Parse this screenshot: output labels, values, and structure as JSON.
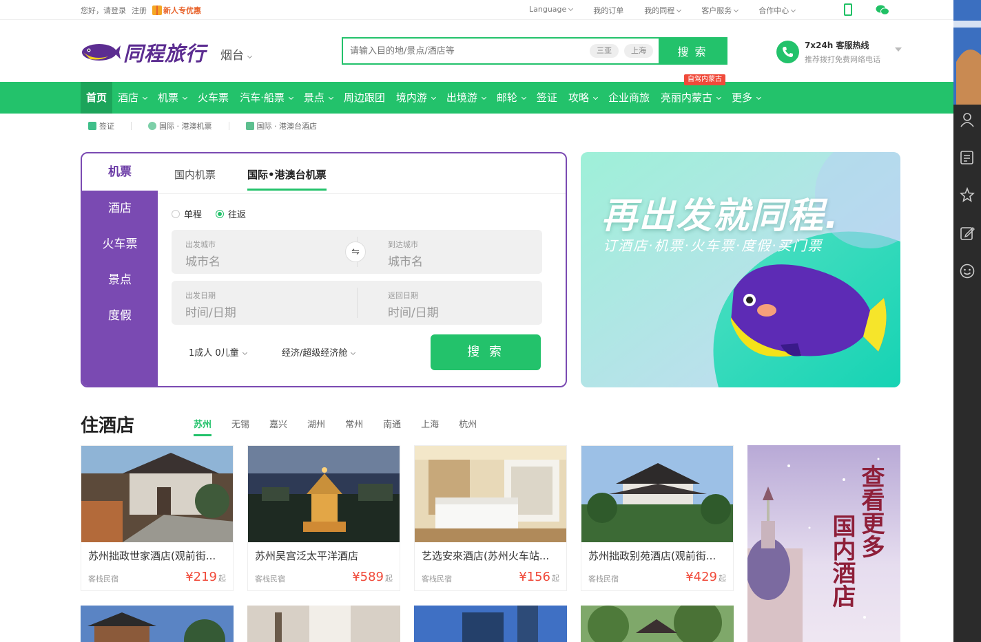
{
  "topbar": {
    "greeting": "您好，请登录",
    "register": "注册",
    "promo": "新人专优惠",
    "language": "Language",
    "my_orders": "我的订单",
    "my_trips": "我的同程",
    "customer_service": "客户服务",
    "partner_center": "合作中心"
  },
  "header": {
    "logo_text": "同程旅行",
    "city": "烟台",
    "search_placeholder": "请输入目的地/景点/酒店等",
    "search_tags": [
      "三亚",
      "上海"
    ],
    "search_button": "搜 索",
    "hotline_title": "7x24h 客服热线",
    "hotline_sub": "推荐拨打免费网络电话"
  },
  "nav": {
    "items": [
      {
        "label": "首页",
        "dropdown": false,
        "active": true
      },
      {
        "label": "酒店",
        "dropdown": true
      },
      {
        "label": "机票",
        "dropdown": true
      },
      {
        "label": "火车票",
        "dropdown": false
      },
      {
        "label": "汽车·船票",
        "dropdown": true
      },
      {
        "label": "景点",
        "dropdown": true
      },
      {
        "label": "周边跟团",
        "dropdown": false
      },
      {
        "label": "境内游",
        "dropdown": true
      },
      {
        "label": "出境游",
        "dropdown": true
      },
      {
        "label": "邮轮",
        "dropdown": true
      },
      {
        "label": "签证",
        "dropdown": false
      },
      {
        "label": "攻略",
        "dropdown": true
      },
      {
        "label": "企业商旅",
        "dropdown": false
      },
      {
        "label": "亮丽内蒙古",
        "dropdown": true,
        "badge": "自驾内蒙古"
      },
      {
        "label": "更多",
        "dropdown": true
      }
    ]
  },
  "subnav": [
    "签证",
    "国际 · 港澳机票",
    "国际 · 港澳台酒店"
  ],
  "booking": {
    "side_items": [
      "机票",
      "酒店",
      "火车票",
      "景点",
      "度假"
    ],
    "tabs": [
      "国内机票",
      "国际•港澳台机票"
    ],
    "trip_types": [
      "单程",
      "往返"
    ],
    "from_label": "出发城市",
    "from_value": "城市名",
    "to_label": "到达城市",
    "to_value": "城市名",
    "depart_label": "出发日期",
    "depart_value": "时间/日期",
    "return_label": "返回日期",
    "return_value": "时间/日期",
    "passengers": "1成人 0儿童",
    "cabin": "经济/超级经济舱",
    "search_button": "搜 索"
  },
  "banner": {
    "headline": "再出发就同程.",
    "subline": "订酒店·机票·火车票·度假·买门票"
  },
  "hotels": {
    "title": "住酒店",
    "cities": [
      "苏州",
      "无锡",
      "嘉兴",
      "湖州",
      "常州",
      "南通",
      "上海",
      "杭州"
    ],
    "cards": [
      {
        "name": "苏州拙政世家酒店(观前街...",
        "type": "客栈民宿",
        "price": "¥219",
        "suffix": "起"
      },
      {
        "name": "苏州吴宫泛太平洋酒店",
        "type": "客栈民宿",
        "price": "¥589",
        "suffix": "起"
      },
      {
        "name": "艺选安來酒店(苏州火车站...",
        "type": "客栈民宿",
        "price": "¥156",
        "suffix": "起"
      },
      {
        "name": "苏州拙政别苑酒店(观前街...",
        "type": "客栈民宿",
        "price": "¥429",
        "suffix": "起"
      }
    ],
    "more_text_1": "查看更多",
    "more_text_2": "国内酒店"
  },
  "colors": {
    "brand_green": "#23c26b",
    "brand_purple": "#7a4ab2",
    "price_red": "#f04a3a"
  }
}
